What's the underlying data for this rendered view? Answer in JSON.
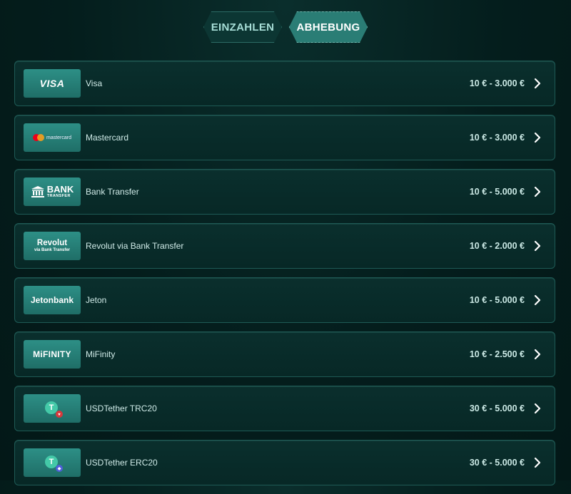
{
  "tabs": {
    "deposit_label": "EINZAHLEN",
    "withdraw_label": "ABHEBUNG",
    "active": "ABHEBUNG"
  },
  "methods": [
    {
      "name": "Visa",
      "limits": "10 € - 3.000 €",
      "logo": {
        "text": "VISA"
      }
    },
    {
      "name": "Mastercard",
      "limits": "10 € - 3.000 €",
      "logo": {
        "text": "mastercard"
      }
    },
    {
      "name": "Bank Transfer",
      "limits": "10 € - 5.000 €",
      "logo": {
        "big": "BANK",
        "small": "TRANSFER",
        "icon": "bank-building-icon"
      }
    },
    {
      "name": "Revolut via Bank Transfer",
      "limits": "10 € - 2.000 €",
      "logo": {
        "big": "Revolut",
        "small": "via Bank Transfer"
      }
    },
    {
      "name": "Jeton",
      "limits": "10 € - 5.000 €",
      "logo": {
        "text": "Jetonbank"
      }
    },
    {
      "name": "MiFinity",
      "limits": "10 € - 2.500 €",
      "logo": {
        "text": "MiFINITY"
      }
    },
    {
      "name": "USDTether TRC20",
      "limits": "30 € - 5.000 €",
      "logo": {
        "icon": "tether-trc20-icon"
      }
    },
    {
      "name": "USDTether ERC20",
      "limits": "30 € - 5.000 €",
      "logo": {
        "icon": "tether-erc20-icon"
      }
    }
  ],
  "colors": {
    "background": "#041d1c",
    "row_background": "#0a2f2d",
    "row_border": "#1e5a55",
    "logo_background": "#2d8f86",
    "active_tab": "#2a7d75",
    "inactive_tab": "#0c3633",
    "tether_green": "#44c9a8",
    "tron_red": "#d9383b",
    "ethereum_blue": "#4f5fd9"
  }
}
